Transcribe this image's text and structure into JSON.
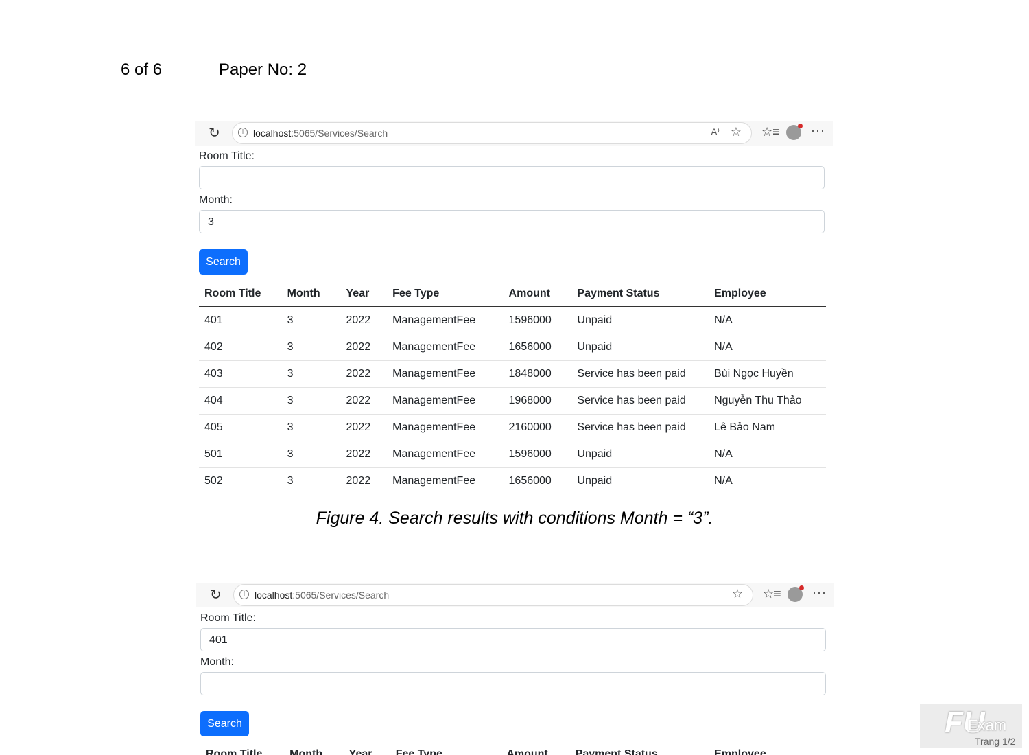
{
  "header": {
    "page": "6 of 6",
    "paper": "Paper No: 2"
  },
  "shot1": {
    "url_host": "localhost",
    "url_path": ":5065/Services/Search",
    "room_title_label": "Room Title:",
    "room_title_value": "",
    "month_label": "Month:",
    "month_value": "3",
    "search_label": "Search",
    "columns": [
      "Room Title",
      "Month",
      "Year",
      "Fee Type",
      "Amount",
      "Payment Status",
      "Employee"
    ],
    "rows": [
      [
        "401",
        "3",
        "2022",
        "ManagementFee",
        "1596000",
        "Unpaid",
        "N/A"
      ],
      [
        "402",
        "3",
        "2022",
        "ManagementFee",
        "1656000",
        "Unpaid",
        "N/A"
      ],
      [
        "403",
        "3",
        "2022",
        "ManagementFee",
        "1848000",
        "Service has been paid",
        "Bùi Ngọc Huyền"
      ],
      [
        "404",
        "3",
        "2022",
        "ManagementFee",
        "1968000",
        "Service has been paid",
        "Nguyễn Thu Thảo"
      ],
      [
        "405",
        "3",
        "2022",
        "ManagementFee",
        "2160000",
        "Service has been paid",
        "Lê Bảo Nam"
      ],
      [
        "501",
        "3",
        "2022",
        "ManagementFee",
        "1596000",
        "Unpaid",
        "N/A"
      ],
      [
        "502",
        "3",
        "2022",
        "ManagementFee",
        "1656000",
        "Unpaid",
        "N/A"
      ]
    ]
  },
  "caption": "Figure 4. Search results with conditions Month = “3”.",
  "shot2": {
    "url_host": "localhost",
    "url_path": ":5065/Services/Search",
    "room_title_label": "Room Title:",
    "room_title_value": "401",
    "month_label": "Month:",
    "month_value": "",
    "search_label": "Search",
    "columns": [
      "Room Title",
      "Month",
      "Year",
      "Fee Type",
      "Amount",
      "Payment Status",
      "Employee"
    ]
  },
  "stamp": {
    "logo": "FU",
    "exam": "Exam",
    "trang": "Trang 1/2"
  },
  "icons": {
    "reload": "reload-icon",
    "info": "info-icon",
    "read_aloud": "read-aloud-icon",
    "favorite": "star-icon",
    "favorites": "favorites-icon",
    "more": "more-icon"
  },
  "colors": {
    "button": "#0d6efd"
  }
}
